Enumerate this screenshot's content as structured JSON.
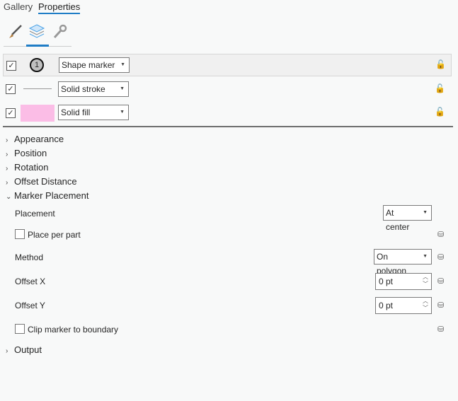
{
  "tabs": {
    "gallery": "Gallery",
    "properties": "Properties"
  },
  "layers": [
    {
      "symbol": "1",
      "type": "Shape marker",
      "checked": true
    },
    {
      "type": "Solid stroke",
      "checked": true
    },
    {
      "type": "Solid fill",
      "checked": true,
      "color": "#fbbde6"
    }
  ],
  "sections": {
    "appearance": "Appearance",
    "position": "Position",
    "rotation": "Rotation",
    "offset_distance": "Offset Distance",
    "marker_placement": "Marker Placement",
    "output": "Output"
  },
  "marker_placement": {
    "placement_label": "Placement",
    "placement_value": "At center",
    "place_per_part": "Place per part",
    "method_label": "Method",
    "method_value": "On polygon",
    "offset_x_label": "Offset X",
    "offset_x_value": "0 pt",
    "offset_y_label": "Offset Y",
    "offset_y_value": "0 pt",
    "clip_label": "Clip marker to boundary"
  },
  "colors": {
    "accent": "#1f7dc6",
    "fill": "#fbbde6"
  }
}
